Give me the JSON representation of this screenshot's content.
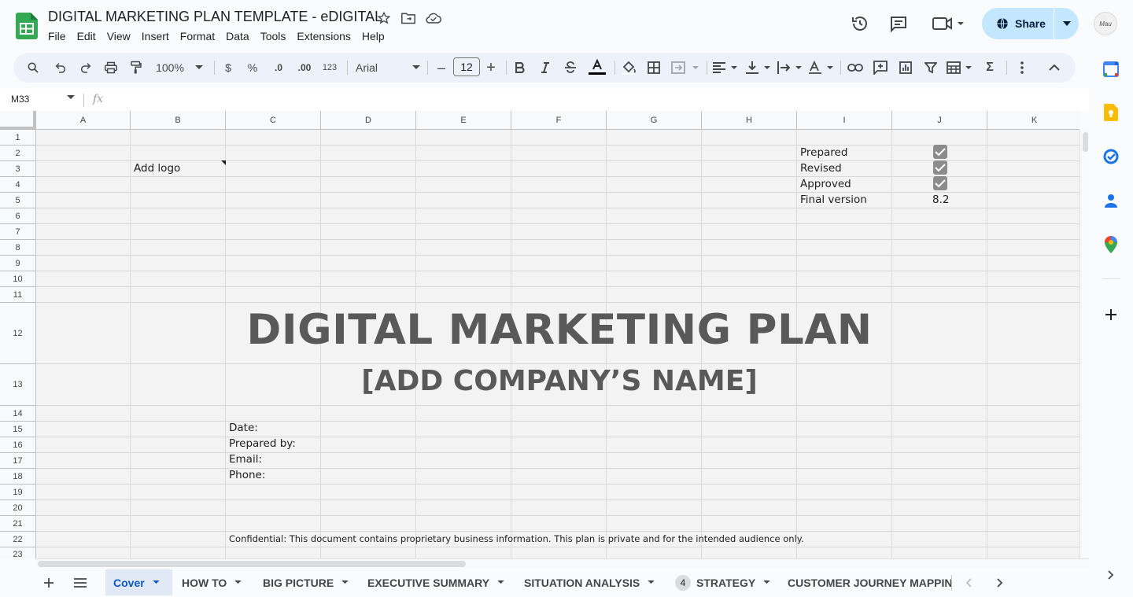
{
  "document": {
    "title": "DIGITAL MARKETING PLAN TEMPLATE - eDIGITAL"
  },
  "menu": [
    "File",
    "Edit",
    "View",
    "Insert",
    "Format",
    "Data",
    "Tools",
    "Extensions",
    "Help"
  ],
  "header_actions": {
    "share_label": "Share",
    "avatar_text": "Mau"
  },
  "toolbar": {
    "zoom": "100%",
    "currency": "$",
    "percent": "%",
    "decrease_decimal": ".0",
    "increase_decimal": ".00",
    "number_format": "123",
    "font_family": "Arial",
    "font_size": "12",
    "minus": "–",
    "plus": "+",
    "sum": "Σ"
  },
  "formula_bar": {
    "cell_reference": "M33",
    "fx": "fx"
  },
  "columns": [
    "A",
    "B",
    "C",
    "D",
    "E",
    "F",
    "G",
    "H",
    "I",
    "J",
    "K"
  ],
  "rows": [
    "1",
    "2",
    "3",
    "4",
    "5",
    "6",
    "7",
    "8",
    "9",
    "10",
    "11",
    "12",
    "13",
    "14",
    "15",
    "16",
    "17",
    "18",
    "19",
    "20",
    "21",
    "22",
    "23"
  ],
  "cells": {
    "add_logo": "Add logo",
    "status": [
      {
        "label": "Prepared",
        "checked": true
      },
      {
        "label": "Revised",
        "checked": true
      },
      {
        "label": "Approved",
        "checked": true
      }
    ],
    "final_version_label": "Final version",
    "final_version_value": "8.2",
    "main_title": "DIGITAL MARKETING PLAN",
    "company_name": "[ADD COMPANY’S NAME]",
    "info_fields": [
      "Date:",
      "Prepared by:",
      "Email:",
      "Phone:"
    ],
    "confidential": "Confidential: This document contains proprietary business information. This plan is private and for the intended audience only."
  },
  "sheet_tabs": {
    "tabs": [
      {
        "label": "Cover",
        "active": true
      },
      {
        "label": "HOW TO",
        "active": false
      },
      {
        "label": "BIG PICTURE",
        "active": false
      },
      {
        "label": "EXECUTIVE SUMMARY",
        "active": false
      },
      {
        "label": "SITUATION ANALYSIS",
        "active": false
      },
      {
        "label": "STRATEGY",
        "active": false,
        "badge": "4"
      },
      {
        "label": "CUSTOMER JOURNEY MAPPIN",
        "active": false
      }
    ]
  },
  "colors": {
    "share_bg": "#c2e7ff",
    "toolbar_bg": "#edf2fa",
    "title_gray": "#595959",
    "checkbox_gray": "#8c8c8c",
    "active_tab": "#0b57d0"
  },
  "icons": [
    "sheets-logo-icon",
    "star-icon",
    "move-folder-icon",
    "cloud-saved-icon",
    "history-icon",
    "comment-icon",
    "video-call-icon",
    "globe-icon",
    "search-icon",
    "undo-icon",
    "redo-icon",
    "print-icon",
    "paint-format-icon",
    "bold-icon",
    "italic-icon",
    "strikethrough-icon",
    "text-color-icon",
    "fill-color-icon",
    "borders-icon",
    "merge-cells-icon",
    "align-left-icon",
    "vertical-align-icon",
    "text-wrap-icon",
    "text-rotate-icon",
    "link-icon",
    "comment-add-icon",
    "chart-icon",
    "filter-icon",
    "table-icon",
    "more-vert-icon",
    "collapse-icon",
    "calendar-icon",
    "keep-icon",
    "tasks-icon",
    "contacts-icon",
    "maps-icon",
    "add-icon"
  ]
}
